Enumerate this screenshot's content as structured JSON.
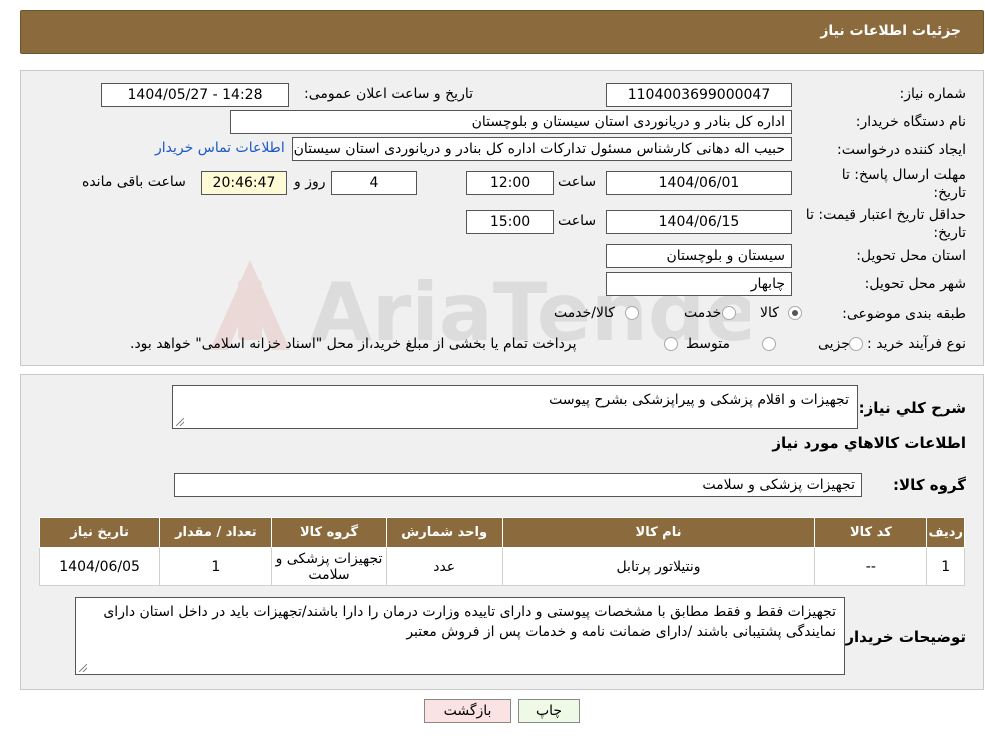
{
  "header": {
    "title": "جزئیات اطلاعات نیاز"
  },
  "form": {
    "need_number": {
      "label": "شماره نیاز:",
      "value": "1104003699000047"
    },
    "announce_datetime": {
      "label": "تاریخ و ساعت اعلان عمومی:",
      "value": "1404/05/27 - 14:28"
    },
    "buyer_org": {
      "label": "نام دستگاه خریدار:",
      "value": "اداره کل بنادر و دریانوردی استان سیستان و بلوچستان"
    },
    "requester": {
      "label": "ایجاد کننده درخواست:",
      "value": "حبیب اله دهانی کارشناس مسئول تدارکات اداره کل بنادر و دریانوردی استان سیستان",
      "contact_link": "اطلاعات تماس خریدار"
    },
    "reply_deadline": {
      "label": "مهلت ارسال پاسخ: تا تاریخ:",
      "date": "1404/06/01",
      "time_label": "ساعت",
      "time": "12:00",
      "days": "4",
      "days_label": "روز و",
      "remaining": "20:46:47",
      "remaining_label": "ساعت باقی مانده"
    },
    "price_validity": {
      "label": "حداقل تاریخ اعتبار قیمت: تا تاریخ:",
      "date": "1404/06/15",
      "time_label": "ساعت",
      "time": "15:00"
    },
    "province": {
      "label": "استان محل تحویل:",
      "value": "سیستان و بلوچستان"
    },
    "city": {
      "label": "شهر محل تحویل:",
      "value": "چابهار"
    },
    "category": {
      "label": "طبقه بندی موضوعی:",
      "options": [
        "کالا",
        "خدمت",
        "کالا/خدمت"
      ],
      "selected": "کالا"
    },
    "process_type": {
      "label": "نوع فرآیند خرید :",
      "options": [
        "جزیی",
        "متوسط"
      ],
      "note": "پرداخت تمام یا بخشی از مبلغ خرید،از محل \"اسناد خزانه اسلامی\" خواهد بود."
    }
  },
  "summary": {
    "label": "شرح کلي نياز:",
    "value": "تجهیزات و اقلام پزشکی و پیراپزشکی بشرح پیوست",
    "items_heading": "اطلاعات کالاهاي مورد نياز",
    "group_label": "گروه کالا:",
    "group_value": "تجهیزات پزشکی و سلامت"
  },
  "table": {
    "headers": [
      "ردیف",
      "کد کالا",
      "نام کالا",
      "واحد شمارش",
      "گروه کالا",
      "تعداد / مقدار",
      "تاریخ نیاز"
    ],
    "rows": [
      [
        "1",
        "--",
        "ونتیلاتور پرتابل",
        "عدد",
        "تجهیزات پزشکی و سلامت",
        "1",
        "1404/06/05"
      ]
    ]
  },
  "buyer_notes": {
    "label": "توضیحات خریدار:",
    "value": "تجهیزات فقط و فقط مطابق با مشخصات پیوستی و دارای تاییده وزارت درمان را دارا باشند/تجهیزات باید در داخل استان دارای نمایندگی پشتیبانی باشند /دارای ضمانت نامه و خدمات پس از فروش معتبر"
  },
  "buttons": {
    "print": "چاپ",
    "back": "بازگشت"
  },
  "colors": {
    "header_bg": "#8b6b3e",
    "panel_bg": "#f0f0f0",
    "link": "#1b58c9",
    "back_btn": "#fbe3e3",
    "print_btn": "#eef9e6"
  },
  "watermark": {
    "text": "AriaTender.neT"
  }
}
